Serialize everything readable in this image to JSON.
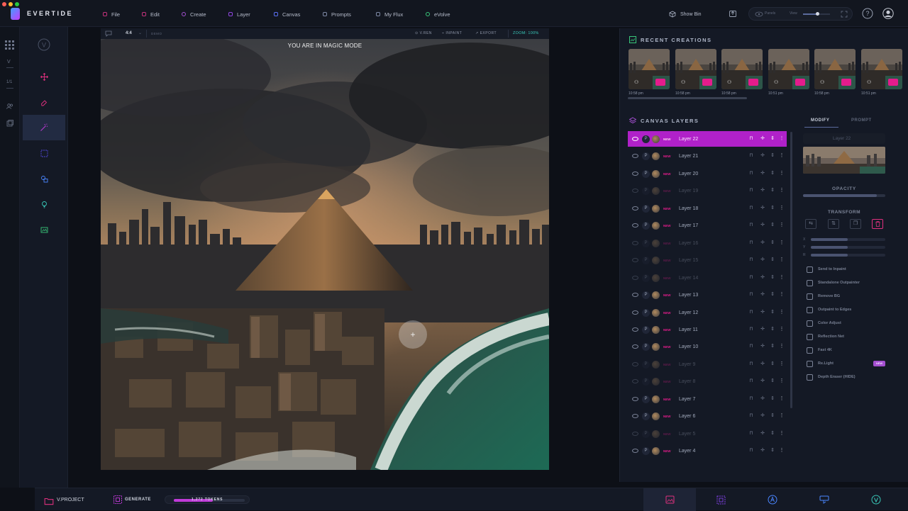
{
  "app": {
    "name": "EVERTIDE"
  },
  "menu": [
    "File",
    "Edit",
    "Create",
    "Layer",
    "Canvas",
    "Prompts",
    "My Flux",
    "eVolve"
  ],
  "topbar_right": {
    "show_bin": "Show Bin",
    "panels_label": "Panels",
    "view_label": "View"
  },
  "left_rail": {
    "labels": [
      "V",
      "1/1"
    ]
  },
  "canvas_toolbar": {
    "ratio": "4:4",
    "demo": "DEMO",
    "vgen": "V.REN",
    "inpaint": "INPAINT",
    "export": "EXPORT",
    "zoom": "ZOOM: 100%"
  },
  "canvas": {
    "banner": "YOU ARE IN MAGIC MODE"
  },
  "recent": {
    "title": "RECENT CREATIONS",
    "items": [
      {
        "time": "10:58 pm"
      },
      {
        "time": "10:58 pm"
      },
      {
        "time": "10:58 pm"
      },
      {
        "time": "10:51 pm"
      },
      {
        "time": "10:58 pm"
      },
      {
        "time": "10:51 pm"
      }
    ]
  },
  "layers": {
    "title": "CANVAS LAYERS",
    "new_badge": "NEW",
    "p_label": "P",
    "items": [
      {
        "name": "Layer 22",
        "active": true,
        "visible": true
      },
      {
        "name": "Layer 21",
        "visible": true
      },
      {
        "name": "Layer 20",
        "visible": true
      },
      {
        "name": "Layer 19",
        "visible": false
      },
      {
        "name": "Layer 18",
        "visible": true
      },
      {
        "name": "Layer 17",
        "visible": true
      },
      {
        "name": "Layer 16",
        "visible": false
      },
      {
        "name": "Layer 15",
        "visible": false
      },
      {
        "name": "Layer 14",
        "visible": false
      },
      {
        "name": "Layer 13",
        "visible": true
      },
      {
        "name": "Layer 12",
        "visible": true
      },
      {
        "name": "Layer 11",
        "visible": true
      },
      {
        "name": "Layer 10",
        "visible": true
      },
      {
        "name": "Layer 9",
        "visible": false
      },
      {
        "name": "Layer 8",
        "visible": false
      },
      {
        "name": "Layer 7",
        "visible": true
      },
      {
        "name": "Layer 6",
        "visible": true
      },
      {
        "name": "Layer 5",
        "visible": false
      },
      {
        "name": "Layer 4",
        "visible": true
      }
    ]
  },
  "modify": {
    "tab_modify": "MODIFY",
    "tab_prompt": "PROMPT",
    "layer_name": "Layer 22",
    "opacity_label": "OPACITY",
    "opacity": 0.9,
    "transform_label": "TRANSFORM",
    "axes": [
      "X",
      "Y",
      "R"
    ],
    "tools": [
      "Send to Inpaint",
      "Standalone Outpainter",
      "Remove BG",
      "Outpaint to Edges",
      "Color Adjust",
      "Reflection Net",
      "Fast 4K",
      "Re.Light",
      "Depth Eraser (HIDE)"
    ],
    "new_badge": "NEW"
  },
  "bottom": {
    "project": "V.PROJECT",
    "generate": "GENERATE",
    "tokens": "1,272 TOKENS",
    "token_fill": 0.55
  },
  "colors": {
    "accent": "#b021c9",
    "pink": "#e31c8c",
    "teal": "#39c7b8",
    "blue": "#4a86ff"
  }
}
